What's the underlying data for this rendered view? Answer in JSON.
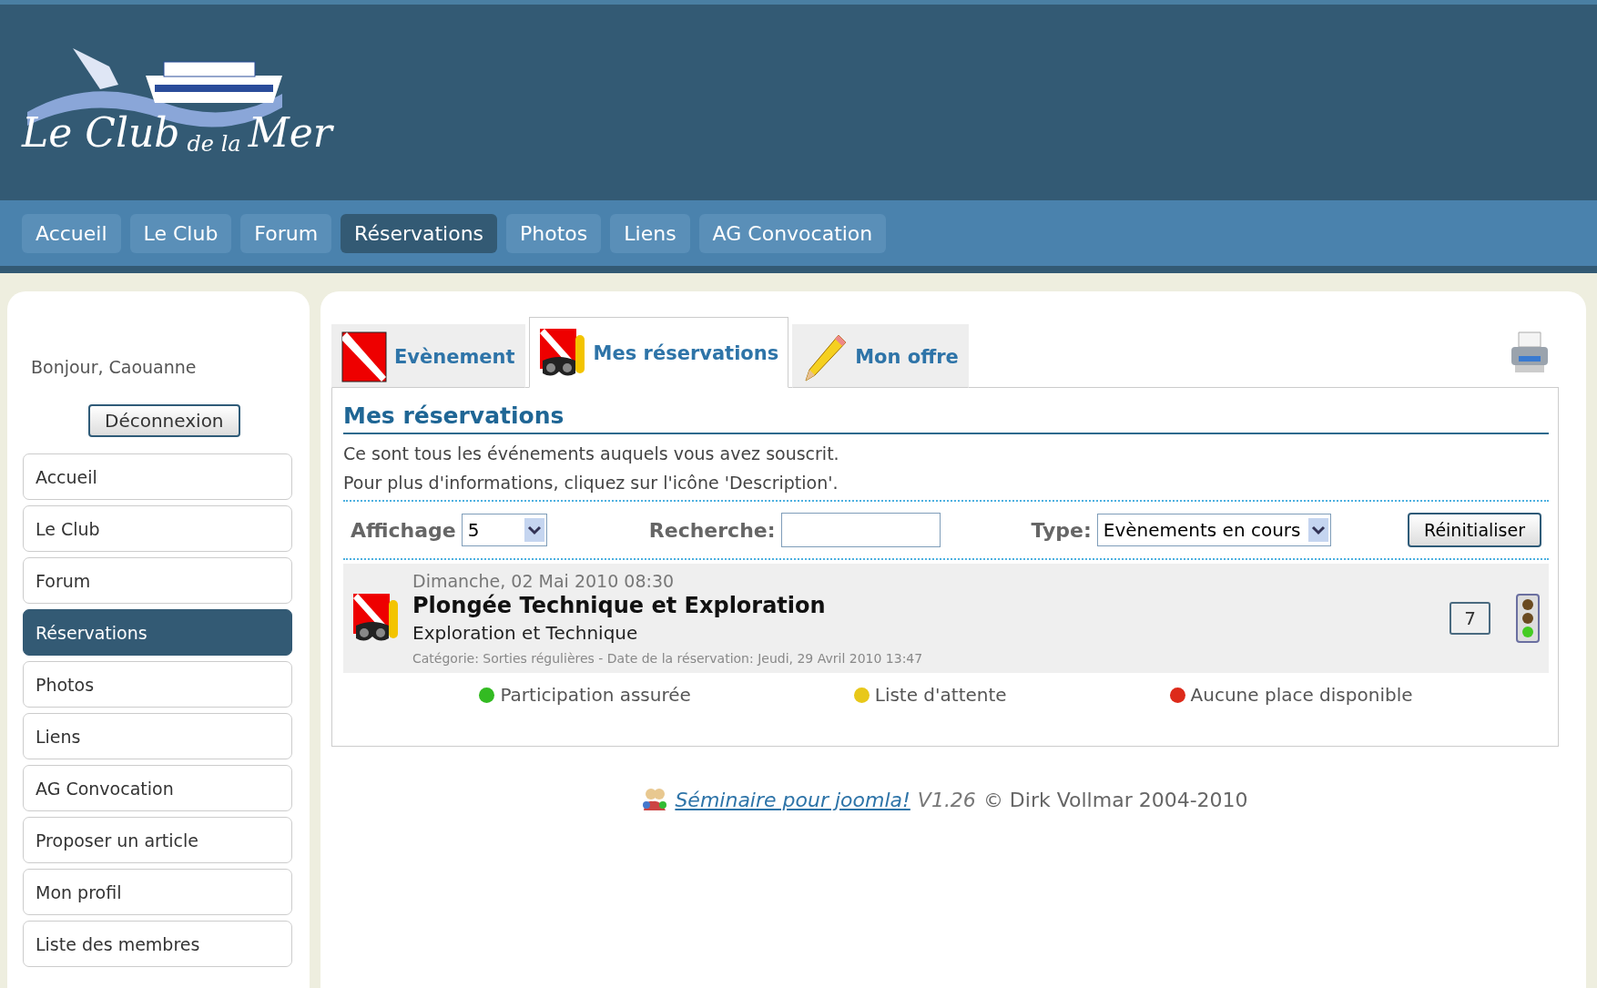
{
  "logo": {
    "words": [
      "Le Club",
      "de la",
      "Mer"
    ]
  },
  "top_nav": [
    {
      "label": "Accueil",
      "selected": false
    },
    {
      "label": "Le Club",
      "selected": false
    },
    {
      "label": "Forum",
      "selected": false
    },
    {
      "label": "Réservations",
      "selected": true
    },
    {
      "label": "Photos",
      "selected": false
    },
    {
      "label": "Liens",
      "selected": false
    },
    {
      "label": "AG Convocation",
      "selected": false
    }
  ],
  "sidebar": {
    "greeting": "Bonjour, Caouanne",
    "logout": "Déconnexion",
    "items": [
      {
        "label": "Accueil",
        "selected": false
      },
      {
        "label": "Le Club",
        "selected": false
      },
      {
        "label": "Forum",
        "selected": false
      },
      {
        "label": "Réservations",
        "selected": true
      },
      {
        "label": "Photos",
        "selected": false
      },
      {
        "label": "Liens",
        "selected": false
      },
      {
        "label": "AG Convocation",
        "selected": false
      },
      {
        "label": "Proposer un article",
        "selected": false
      },
      {
        "label": "Mon profil",
        "selected": false
      },
      {
        "label": "Liste des membres",
        "selected": false
      }
    ]
  },
  "tabs": [
    {
      "label": "Evènement",
      "kind": "flag",
      "selected": false
    },
    {
      "label": "Mes réservations",
      "kind": "diver",
      "selected": true
    },
    {
      "label": "Mon offre",
      "kind": "pencil",
      "selected": false
    }
  ],
  "section": {
    "title": "Mes réservations",
    "lines": [
      "Ce sont tous les événements auquels vous avez souscrit.",
      "Pour plus d'informations, cliquez sur l'icône 'Description'."
    ]
  },
  "filters": {
    "display_label": "Affichage",
    "display_value": "5",
    "search_label": "Recherche:",
    "type_label": "Type:",
    "type_value": "Evènements en cours",
    "reset": "Réinitialiser"
  },
  "event": {
    "date": "Dimanche, 02 Mai 2010 08:30",
    "title": "Plongée Technique et Exploration",
    "subtitle": "Exploration et Technique",
    "meta": "Catégorie: Sorties régulières - Date de la réservation: Jeudi, 29 Avril 2010 13:47",
    "count": "7",
    "lamps": [
      {
        "on": false
      },
      {
        "on": false
      },
      {
        "on": true
      }
    ]
  },
  "legend": [
    {
      "label": "Participation assurée",
      "color": "#33bb22"
    },
    {
      "label": "Liste d'attente",
      "color": "#e8c81a"
    },
    {
      "label": "Aucune place disponible",
      "color": "#dd2a1a"
    }
  ],
  "footer": {
    "link": "Séminaire pour joomla!",
    "version": "V1.26",
    "copyright": "© Dirk Vollmar 2004-2010"
  }
}
